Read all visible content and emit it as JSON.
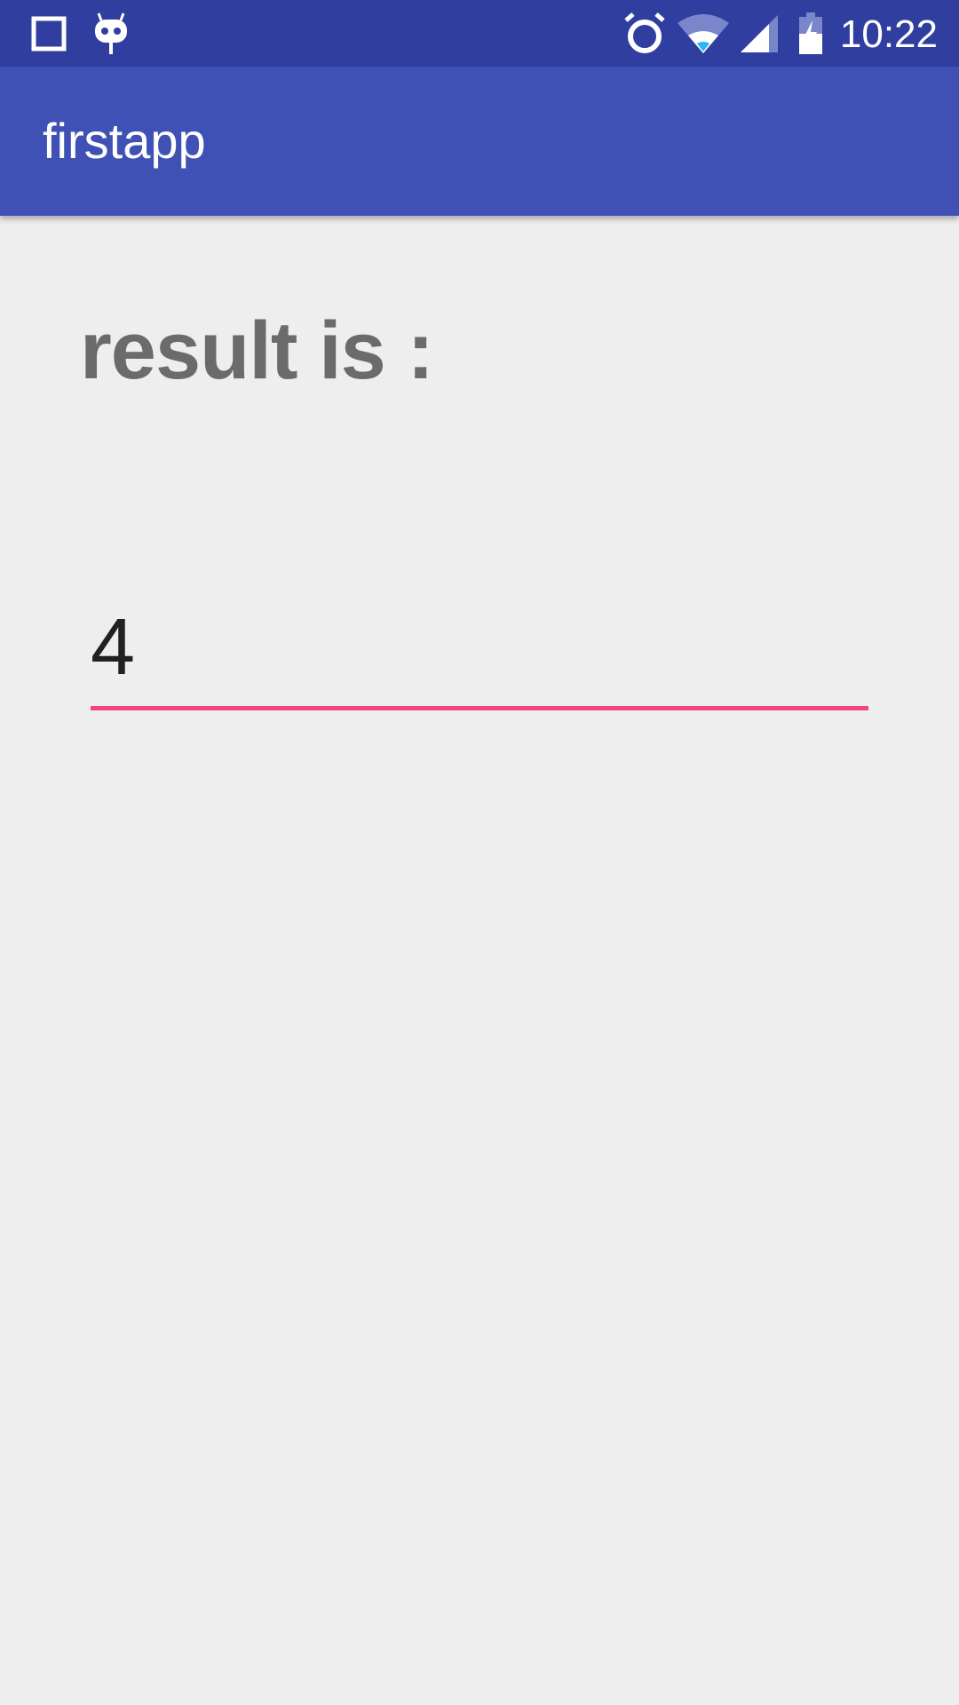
{
  "status_bar": {
    "time": "10:22",
    "background": "#303f9f",
    "icons": [
      "notification-square-icon",
      "cyanogen-mod-icon",
      "alarm-icon",
      "wifi-icon",
      "cell-signal-icon",
      "battery-charging-icon"
    ]
  },
  "app_bar": {
    "title": "firstapp",
    "background": "#3f51b5"
  },
  "main": {
    "result_label": "result is :",
    "result_value": "4",
    "accent_color": "#f0457f"
  }
}
